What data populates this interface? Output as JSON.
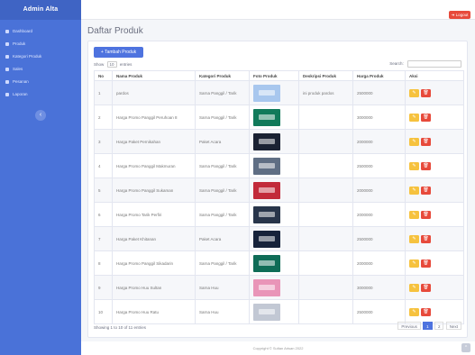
{
  "app": {
    "brand": "Admin Alta",
    "logout_label": "➜ Logout"
  },
  "sidebar": {
    "items": [
      {
        "label": "Dashboard",
        "icon": "dashboard-icon"
      },
      {
        "label": "Produk",
        "icon": "box-icon"
      },
      {
        "label": "Kategori Produk",
        "icon": "tags-icon"
      },
      {
        "label": "Sales",
        "icon": "users-icon"
      },
      {
        "label": "Pesanan",
        "icon": "cart-icon"
      },
      {
        "label": "Laporan",
        "icon": "report-icon"
      }
    ],
    "toggle_symbol": "‹"
  },
  "page": {
    "title": "Daftar Produk",
    "add_button": "+ Tambah Produk",
    "show_prefix": "Show",
    "show_value": "10",
    "show_suffix": "entries",
    "search_label": "Search:",
    "search_value": ""
  },
  "table": {
    "columns": [
      "No",
      "Nama Produk",
      "Kategori Produk",
      "Foto Produk",
      "Deskripsi Produk",
      "Harga Produk",
      "Aksi"
    ],
    "rows": [
      {
        "no": "1",
        "nama": "pardos",
        "kategori": "Sarna Panggil / Tarik",
        "deskripsi": "ini produk pardos",
        "harga": "2500000",
        "thumb": "#a8c7ee"
      },
      {
        "no": "2",
        "nama": "Harga Promo Panggil Peruhoan 8",
        "kategori": "Sarna Panggil / Tarik",
        "deskripsi": "",
        "harga": "3000000",
        "thumb": "#117a5a"
      },
      {
        "no": "3",
        "nama": "Harga Paket Pernikahan",
        "kategori": "Paket Acara",
        "deskripsi": "",
        "harga": "2000000",
        "thumb": "#1b2233"
      },
      {
        "no": "4",
        "nama": "Harga Promo Panggil Makmuran",
        "kategori": "Sarna Panggil / Tarik",
        "deskripsi": "",
        "harga": "2500000",
        "thumb": "#5f6e84"
      },
      {
        "no": "5",
        "nama": "Harga Promo Panggil Sukaman",
        "kategori": "Sarna Panggil / Tarik",
        "deskripsi": "",
        "harga": "2000000",
        "thumb": "#c22a3a"
      },
      {
        "no": "6",
        "nama": "Harga Promo Tarik Perfiri",
        "kategori": "Sarna Panggil / Tarik",
        "deskripsi": "",
        "harga": "2000000",
        "thumb": "#28354a"
      },
      {
        "no": "7",
        "nama": "Harga Paket Khitanan",
        "kategori": "Paket Acara",
        "deskripsi": "",
        "harga": "2500000",
        "thumb": "#16223a"
      },
      {
        "no": "8",
        "nama": "Harga Promo Panggil Sikadarin",
        "kategori": "Sarna Panggil / Tarik",
        "deskripsi": "",
        "harga": "2000000",
        "thumb": "#0f6c57"
      },
      {
        "no": "9",
        "nama": "Harga Promo Huu Sultan",
        "kategori": "Sarna Huu",
        "deskripsi": "",
        "harga": "3000000",
        "thumb": "#e995b8"
      },
      {
        "no": "10",
        "nama": "Harga Promo Huu Ratu",
        "kategori": "Sarna Huu",
        "deskripsi": "",
        "harga": "2500000",
        "thumb": "#c2c8d4"
      }
    ],
    "edit_symbol": "✎",
    "delete_symbol": "🗑"
  },
  "footer": {
    "info": "Showing 1 to 10 of 11 entries",
    "prev": "Previous",
    "pages": [
      "1",
      "2"
    ],
    "active_page": "1",
    "next": "Next",
    "copyright": "Copyright © Sultan Arisan 2022",
    "scroll_top_symbol": "^"
  },
  "colors": {
    "sidebar": "#4a72d8",
    "primary": "#4e73df",
    "warning": "#f6c23e",
    "danger": "#e74a3b"
  }
}
